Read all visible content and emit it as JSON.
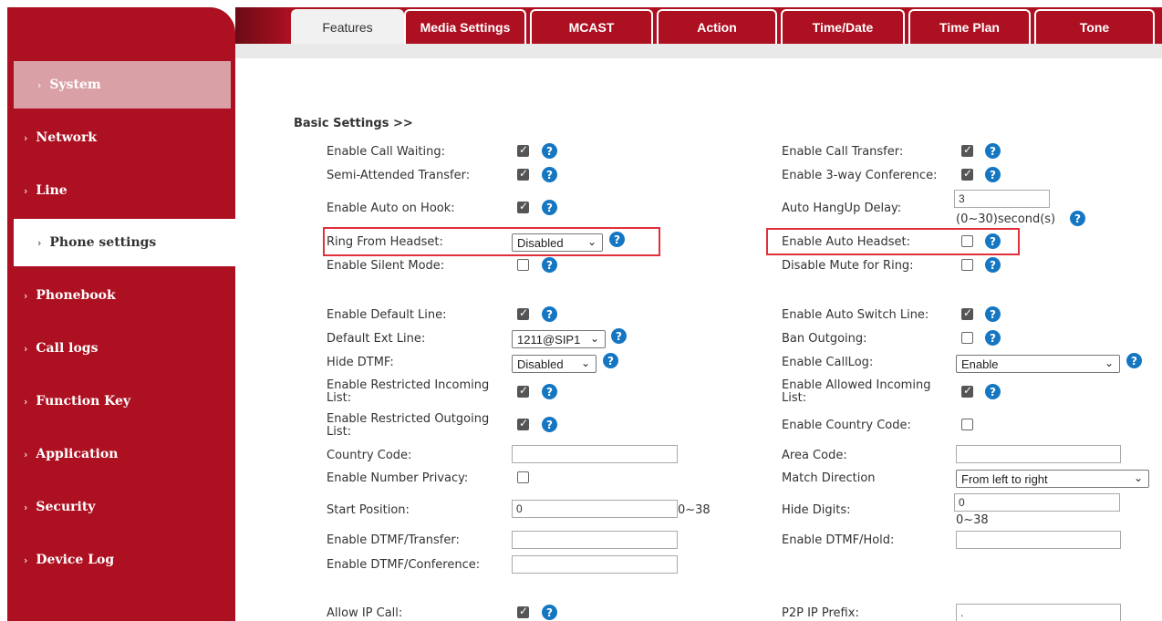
{
  "sidebar": {
    "items": [
      {
        "label": "System"
      },
      {
        "label": "Network"
      },
      {
        "label": "Line"
      },
      {
        "label": "Phone settings"
      },
      {
        "label": "Phonebook"
      },
      {
        "label": "Call logs"
      },
      {
        "label": "Function Key"
      },
      {
        "label": "Application"
      },
      {
        "label": "Security"
      },
      {
        "label": "Device Log"
      }
    ],
    "active": "Phone settings"
  },
  "tabs": [
    {
      "label": "Features",
      "active": true
    },
    {
      "label": "Media Settings"
    },
    {
      "label": "MCAST"
    },
    {
      "label": "Action"
    },
    {
      "label": "Time/Date"
    },
    {
      "label": "Time Plan"
    },
    {
      "label": "Tone"
    }
  ],
  "section_title": "Basic Settings >>",
  "fields": {
    "enable_call_waiting": {
      "label": "Enable Call Waiting:",
      "checked": true
    },
    "semi_attended_transfer": {
      "label": "Semi-Attended Transfer:",
      "checked": true
    },
    "enable_auto_on_hook": {
      "label": "Enable Auto on Hook:",
      "checked": true
    },
    "ring_from_headset": {
      "label": "Ring From Headset:",
      "value": "Disabled"
    },
    "enable_silent_mode": {
      "label": "Enable Silent Mode:",
      "checked": false
    },
    "enable_default_line": {
      "label": "Enable Default Line:",
      "checked": true
    },
    "default_ext_line": {
      "label": "Default Ext Line:",
      "value": "1211@SIP1"
    },
    "hide_dtmf": {
      "label": "Hide DTMF:",
      "value": "Disabled"
    },
    "enable_restricted_incoming": {
      "label_line1": "Enable Restricted Incoming",
      "label_line2": "List:",
      "checked": true
    },
    "enable_restricted_outgoing": {
      "label_line1": "Enable Restricted Outgoing",
      "label_line2": "List:",
      "checked": true
    },
    "country_code": {
      "label": "Country Code:",
      "value": ""
    },
    "enable_number_privacy": {
      "label": "Enable Number Privacy:",
      "checked": false
    },
    "start_position": {
      "label": "Start Position:",
      "value": "0",
      "hint": "0~38"
    },
    "enable_dtmf_transfer": {
      "label": "Enable DTMF/Transfer:",
      "value": ""
    },
    "enable_dtmf_conference": {
      "label": "Enable DTMF/Conference:",
      "value": ""
    },
    "allow_ip_call": {
      "label": "Allow IP Call:",
      "checked": true
    },
    "enable_call_transfer": {
      "label": "Enable Call Transfer:",
      "checked": true
    },
    "enable_3way_conference": {
      "label": "Enable 3-way Conference:",
      "checked": true
    },
    "auto_hangup_delay": {
      "label": "Auto HangUp Delay:",
      "value": "3",
      "hint": "(0~30)second(s)"
    },
    "enable_auto_headset": {
      "label": "Enable Auto Headset:",
      "checked": false
    },
    "disable_mute_for_ring": {
      "label": "Disable Mute for Ring:",
      "checked": false
    },
    "enable_auto_switch_line": {
      "label": "Enable Auto Switch Line:",
      "checked": true
    },
    "ban_outgoing": {
      "label": "Ban Outgoing:",
      "checked": false
    },
    "enable_calllog": {
      "label": "Enable CallLog:",
      "value": "Enable"
    },
    "enable_allowed_incoming": {
      "label_line1": "Enable Allowed Incoming",
      "label_line2": "List:",
      "checked": true
    },
    "enable_country_code": {
      "label": "Enable Country Code:",
      "checked": false
    },
    "area_code": {
      "label": "Area Code:",
      "value": ""
    },
    "match_direction": {
      "label": "Match Direction",
      "value": "From left to right"
    },
    "hide_digits": {
      "label": "Hide Digits:",
      "value": "0",
      "hint": "0~38"
    },
    "enable_dtmf_hold": {
      "label": "Enable DTMF/Hold:",
      "value": ""
    },
    "p2p_ip_prefix": {
      "label": "P2P IP Prefix:",
      "value": "."
    }
  },
  "colors": {
    "brand": "#ad1021",
    "help": "#1576c2",
    "highlight": "#e0303a"
  }
}
